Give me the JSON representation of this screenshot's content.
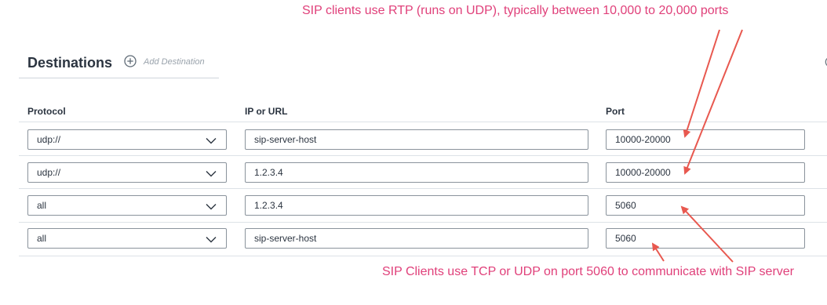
{
  "annotations": {
    "top": "SIP clients use RTP (runs on UDP), typically between 10,000 to 20,000 ports",
    "bottom": "SIP Clients use TCP or UDP on port 5060 to communicate with SIP server"
  },
  "section": {
    "title": "Destinations",
    "add_label": "Add Destination",
    "add_icon": "plus-circle-icon"
  },
  "columns": {
    "protocol": "Protocol",
    "ip": "IP or URL",
    "port": "Port"
  },
  "rows": [
    {
      "protocol": "udp://",
      "ip": "sip-server-host",
      "port": "10000-20000"
    },
    {
      "protocol": "udp://",
      "ip": "1.2.3.4",
      "port": "10000-20000"
    },
    {
      "protocol": "all",
      "ip": "1.2.3.4",
      "port": "5060"
    },
    {
      "protocol": "all",
      "ip": "sip-server-host",
      "port": "5060"
    }
  ],
  "colors": {
    "annotation": "#e0407a",
    "arrow": "#e8584f"
  }
}
